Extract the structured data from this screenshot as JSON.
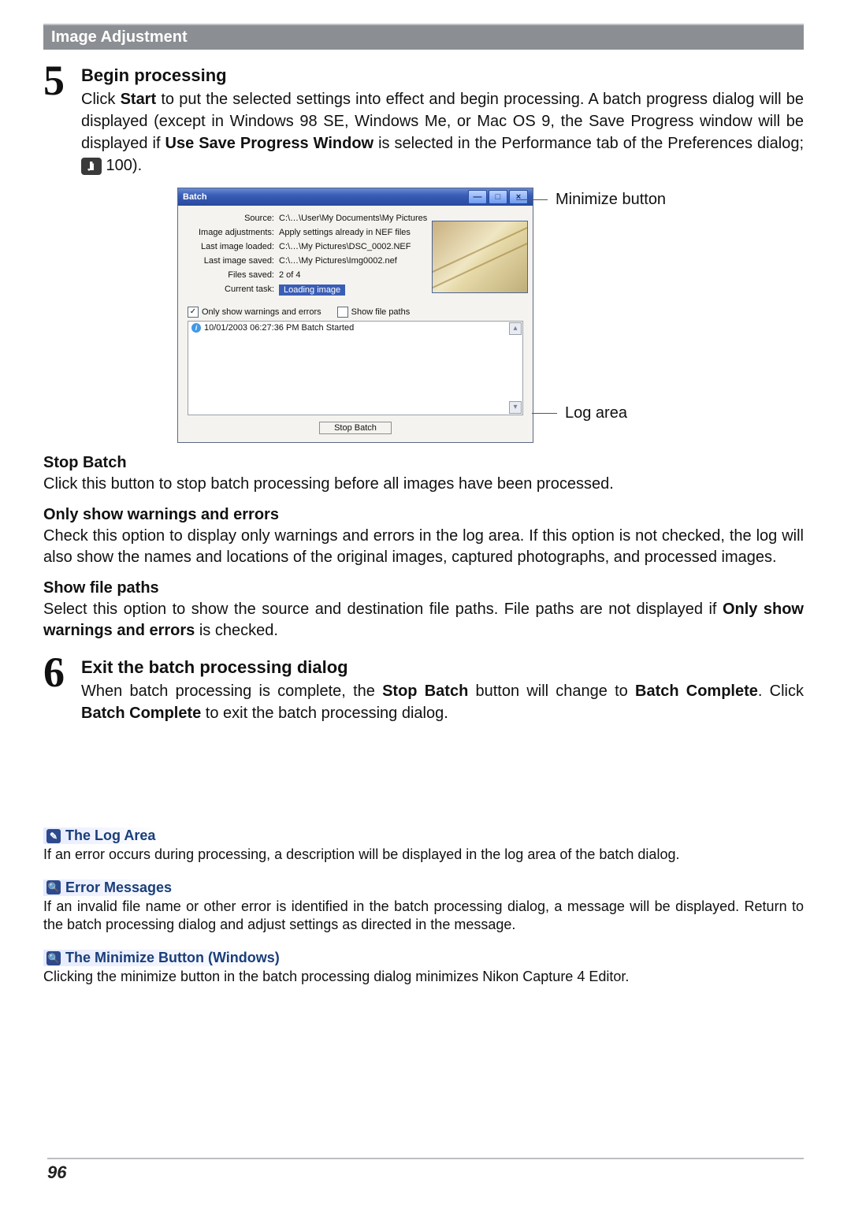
{
  "header": {
    "section_title": "Image Adjustment"
  },
  "step5": {
    "number": "5",
    "title": "Begin processing",
    "body_1": "Click ",
    "body_start": "Start",
    "body_2": " to put the selected settings into effect and begin processing. A batch progress dialog will be displayed (except in Windows 98 SE, Windows Me, or Mac OS 9, the Save Progress window will be displayed if ",
    "body_bold2": "Use Save Progress Window",
    "body_3": " is selected in the Performance tab of the Preferences dialog; ",
    "page_ref": " 100)."
  },
  "dialog": {
    "title": "Batch",
    "btn_min": "—",
    "btn_max": "□",
    "btn_close": "×",
    "rows": {
      "source_k": "Source:",
      "source_v": "C:\\…\\User\\My Documents\\My Pictures",
      "adj_k": "Image adjustments:",
      "adj_v": "Apply settings already in NEF files",
      "loaded_k": "Last image loaded:",
      "loaded_v": "C:\\…\\My Pictures\\DSC_0002.NEF",
      "saved_k": "Last image saved:",
      "saved_v": "C:\\…\\My Pictures\\Img0002.nef",
      "files_k": "Files saved:",
      "files_v": "2 of 4",
      "task_k": "Current task:",
      "task_v": "Loading image"
    },
    "only_warn": "Only show warnings and errors",
    "show_paths": "Show file paths",
    "log_line_i": "i",
    "log_line": "10/01/2003 06:27:36 PM  Batch Started",
    "stop_btn": "Stop Batch"
  },
  "callouts": {
    "min_btn": "Minimize button",
    "log_area": "Log area"
  },
  "defs": {
    "stop_title": "Stop Batch",
    "stop_body": "Click this button to stop batch processing before all images have been processed.",
    "warn_title": "Only show warnings and errors",
    "warn_body": "Check this option to display only warnings and errors in the log area. If this option is not checked, the log will also show the names and locations of the original images, captured photographs, and processed images.",
    "paths_title": "Show file paths",
    "paths_body_1": "Select this option to show the source and destination file paths. File paths are not displayed if ",
    "paths_body_bold": "Only show warnings and errors",
    "paths_body_2": " is checked."
  },
  "step6": {
    "number": "6",
    "title": "Exit the batch processing dialog",
    "body_1": "When batch processing is complete, the ",
    "body_b1": "Stop Batch",
    "body_2": " button will change to ",
    "body_b2": "Batch Complete",
    "body_3": ". Click ",
    "body_b3": "Batch Complete",
    "body_4": " to exit the batch processing dialog."
  },
  "notes": {
    "log_t": "The Log Area",
    "log_b": "If an error occurs during processing, a description will be displayed in the log area of the batch dialog.",
    "err_t": "Error Messages",
    "err_b": "If an invalid file name or other error is identified in the batch processing dialog, a message will be displayed. Return to the batch processing dialog and adjust settings as directed in the message.",
    "min_t": "The Minimize Button (Windows)",
    "min_b": "Clicking the minimize button in the batch processing dialog minimizes Nikon Capture 4 Editor."
  },
  "page_number": "96"
}
